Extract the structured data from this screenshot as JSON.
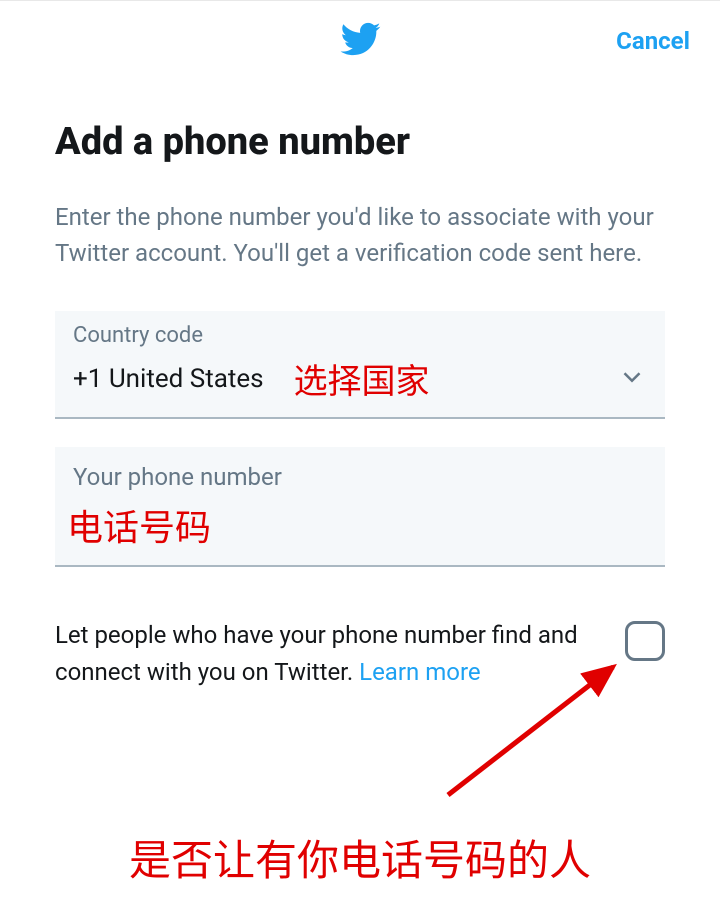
{
  "header": {
    "cancel_label": "Cancel"
  },
  "main": {
    "title": "Add a phone number",
    "description": "Enter the phone number you'd like to associate with your Twitter account. You'll get a verification code sent here.",
    "country_code": {
      "label": "Country code",
      "value": "+1 United States"
    },
    "phone": {
      "label": "Your phone number"
    },
    "consent": {
      "text": "Let people who have your phone number find and connect with you on Twitter. ",
      "learn_more": "Learn more",
      "checked": false
    }
  },
  "annotations": {
    "country": "选择国家",
    "phone": "电话号码",
    "bottom": "是否让有你电话号码的人"
  }
}
